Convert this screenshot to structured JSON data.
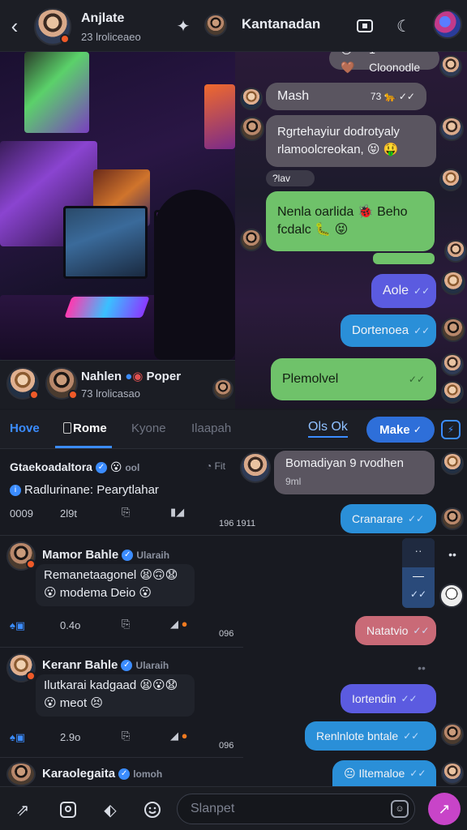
{
  "header": {
    "back_icon": "back-arrow-icon",
    "profile_name": "Anjlate",
    "profile_sub": "23 lroliceaeo",
    "sparkle_icon": "sparkle-icon",
    "chat_title": "Kantanadan",
    "icons": [
      "video-icon",
      "moon-icon",
      "globe-avatar-icon"
    ]
  },
  "image_card": {
    "user_name": "Nahlen",
    "badge_text": "Poper",
    "sub": "73 lrolicasao"
  },
  "chat": {
    "messages": [
      {
        "text": "1 Cloonodle",
        "prefix_emoji": "😯🤎"
      },
      {
        "text": "Mash",
        "time": "73 🐆 ✓✓"
      },
      {
        "text": "Rgrtehayiur dodrotyaly rlamoolcreokan, 😝 🤑"
      },
      {
        "label": "?lav"
      },
      {
        "text": "Nenla oarlida 🐞 Beho fcdalc 🐛 😝"
      },
      {
        "text": "Aole",
        "check": "✓✓"
      },
      {
        "text": "Dortenoea",
        "check": "✓✓"
      },
      {
        "text": "Plemolvel",
        "check": "✓✓"
      }
    ]
  },
  "tabs": {
    "items": [
      "Hove",
      "Rome",
      "Kyone",
      "Ilaapah"
    ],
    "active": "Rome",
    "status_label": "Ols Ok",
    "make_button": "Make",
    "shield_icon": "shield-icon"
  },
  "feed": {
    "posts": [
      {
        "name": "Gtaekoadaltora",
        "meta": "ool",
        "time": "Fit",
        "body_line1": "Radlurinane: Pearytlahar",
        "views": "0009",
        "count": "2l9t",
        "side": "196 1911"
      },
      {
        "name": "Mamor Bahle",
        "handle": "Ularaih",
        "body_line1": "Remanetaagonel 😫🙃😧",
        "body_line2": "😮 modema Deio 😮",
        "count": "0.4o",
        "side": "096"
      },
      {
        "name": "Keranr Bahle",
        "handle": "Ularaih",
        "body_line1": "Ilutkarai kadgaad 😫😮😧",
        "body_line2": "😮 meot 😣",
        "count": "2.9o",
        "side": "096"
      },
      {
        "name": "Karaolegaita",
        "handle": "lomoh"
      }
    ],
    "dms": [
      {
        "text": "Bomadiyan 9 rvodhen",
        "sub": "9ml"
      },
      {
        "text": "Cranarare",
        "check": "✓✓"
      },
      {
        "text": "Natatvio",
        "check": "✓✓"
      },
      {
        "text": "Iortendin",
        "check": "✓✓"
      },
      {
        "text": "Renlnlote bntale",
        "check": "✓✓"
      },
      {
        "text": "Iltemaloe",
        "check": "✓✓"
      }
    ],
    "mini_card": {
      "top": "··",
      "middle": "—",
      "check": "✓✓"
    }
  },
  "composer": {
    "placeholder": "Slanpet",
    "icons": [
      "shortcut-icon",
      "image-icon",
      "tag-icon",
      "emoji-icon",
      "sticker-icon",
      "send-icon"
    ]
  },
  "colors": {
    "accent_blue": "#2e6fd9",
    "bubble_gray": "#5a5560",
    "bubble_green": "#6fc26a",
    "bubble_purple": "#5b5be0",
    "bubble_cyan": "#2a8fd8",
    "bubble_rose": "#c96a77",
    "send_button": "#c844c8"
  }
}
